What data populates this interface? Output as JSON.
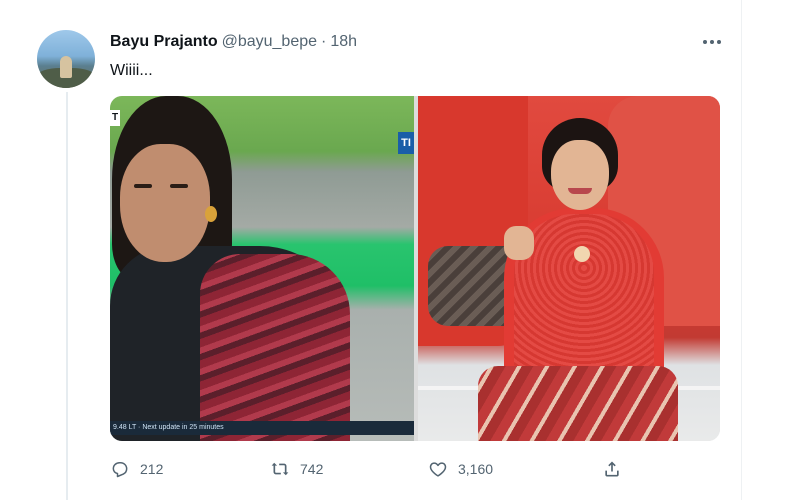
{
  "tweet": {
    "author_name": "Bayu Prajanto",
    "handle": "@bayu_bepe",
    "separator": "·",
    "time": "18h",
    "text": "Wiiii...",
    "more_icon": "more-horizontal-icon",
    "media": {
      "left_caption": "9.48 LT · Next update in 25 minutes",
      "left_logo": "T",
      "left_logo2": "TI"
    },
    "actions": {
      "reply_count": "212",
      "retweet_count": "742",
      "like_count": "3,160",
      "share_icon": "share-icon"
    }
  },
  "colors": {
    "text_primary": "#0f1419",
    "text_secondary": "#536471",
    "thread_line": "#e6ecf0"
  }
}
